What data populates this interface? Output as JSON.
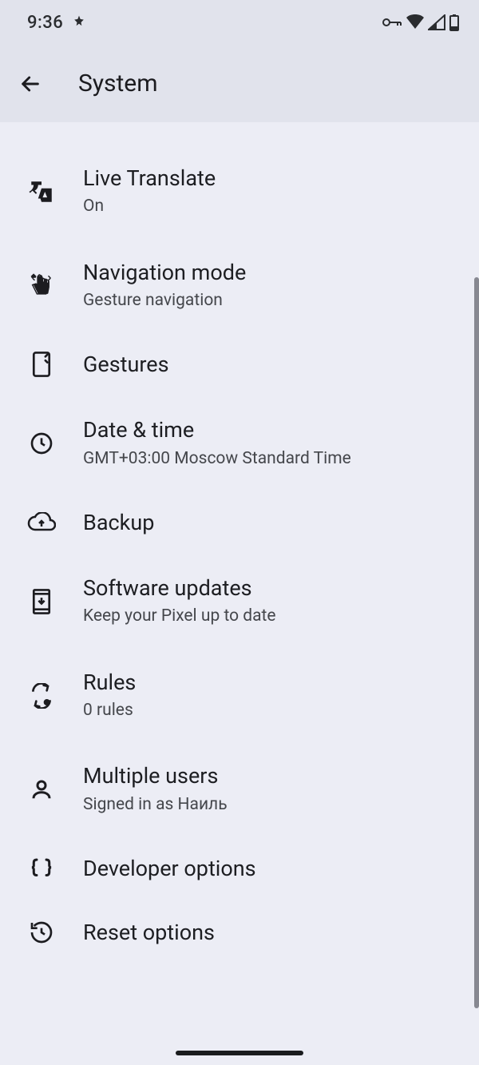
{
  "status": {
    "time": "9:36"
  },
  "header": {
    "title": "System"
  },
  "items": [
    {
      "title": "Live Translate",
      "sub": "On"
    },
    {
      "title": "Navigation mode",
      "sub": "Gesture navigation"
    },
    {
      "title": "Gestures",
      "sub": null
    },
    {
      "title": "Date & time",
      "sub": "GMT+03:00 Moscow Standard Time"
    },
    {
      "title": "Backup",
      "sub": null
    },
    {
      "title": "Software updates",
      "sub": "Keep your Pixel up to date"
    },
    {
      "title": "Rules",
      "sub": "0 rules"
    },
    {
      "title": "Multiple users",
      "sub": "Signed in as Наиль"
    },
    {
      "title": "Developer options",
      "sub": null
    },
    {
      "title": "Reset options",
      "sub": null
    }
  ]
}
